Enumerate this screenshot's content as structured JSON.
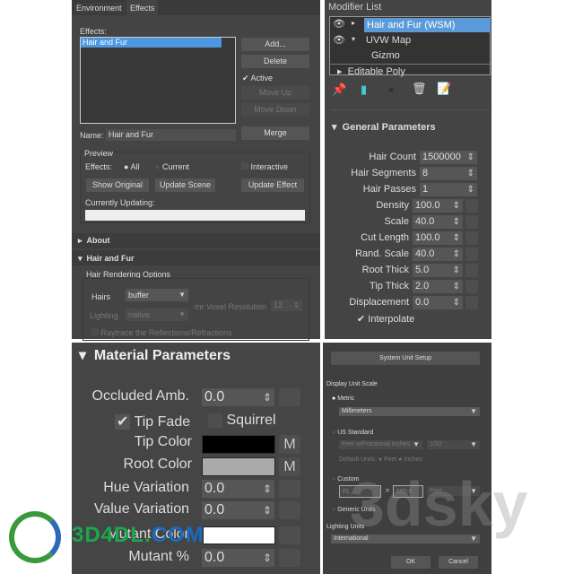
{
  "effects_panel": {
    "tabs": [
      "Environment",
      "Effects"
    ],
    "effects_label": "Effects:",
    "effects_list": [
      "Hair and Fur"
    ],
    "buttons": {
      "add": "Add...",
      "delete": "Delete",
      "move_up": "Move Up",
      "move_down": "Move Down",
      "merge": "Merge"
    },
    "active_label": "Active",
    "name_label": "Name:",
    "name_value": "Hair and Fur",
    "preview": {
      "title": "Preview",
      "effects_label": "Effects:",
      "all": "All",
      "current": "Current",
      "interactive": "Interactive",
      "show_original": "Show Original",
      "update_scene": "Update Scene",
      "update_effect": "Update Effect",
      "currently_updating": "Currently Updating:"
    },
    "about": "About",
    "hair_and_fur": "Hair and Fur",
    "hair_rendering_options": "Hair Rendering Options",
    "hairs_label": "Hairs",
    "hairs_value": "buffer",
    "lighting_label": "Lighting",
    "lighting_value": "native",
    "voxel_label": "mr Voxel Resolution",
    "voxel_value": "12",
    "raytrace_label": "Raytrace the Reflections/Refractions"
  },
  "modifier_panel": {
    "title": "Modifier List",
    "stack": [
      "Hair and Fur (WSM)",
      "UVW Map",
      "Gizmo",
      "Editable Poly"
    ],
    "section": "General Parameters",
    "params": [
      {
        "label": "Hair Count",
        "value": "1500000"
      },
      {
        "label": "Hair Segments",
        "value": "8"
      },
      {
        "label": "Hair Passes",
        "value": "1"
      },
      {
        "label": "Density",
        "value": "100.0"
      },
      {
        "label": "Scale",
        "value": "40.0"
      },
      {
        "label": "Cut Length",
        "value": "100.0"
      },
      {
        "label": "Rand. Scale",
        "value": "40.0"
      },
      {
        "label": "Root Thick",
        "value": "5.0"
      },
      {
        "label": "Tip Thick",
        "value": "2.0"
      },
      {
        "label": "Displacement",
        "value": "0.0"
      }
    ],
    "interpolate": "Interpolate"
  },
  "material_panel": {
    "title": "Material Parameters",
    "occluded_label": "Occluded Amb.",
    "occluded_value": "0.0",
    "tip_fade": "Tip Fade",
    "squirrel": "Squirrel",
    "tip_color_label": "Tip Color",
    "tip_color": "#000000",
    "root_color_label": "Root Color",
    "root_color": "#aaaaaa",
    "map_button": "M",
    "hue_label": "Hue Variation",
    "hue_value": "0.0",
    "value_label": "Value Variation",
    "value_value": "0.0",
    "mutant_color_label": "Mutant Color",
    "mutant_color": "#ffffff",
    "mutant_pct_label": "Mutant %",
    "mutant_pct_value": "0.0"
  },
  "units_panel": {
    "system_unit_setup": "System Unit Setup",
    "display_unit_scale": "Display Unit Scale",
    "metric": "Metric",
    "metric_value": "Millimeters",
    "us_standard": "US Standard",
    "us_value": "Feet w/Fractional Inches",
    "us_fraction": "1/32",
    "default_units": "Default Units:",
    "feet": "Feet",
    "inches": "Inches",
    "custom": "Custom",
    "custom_left": "FL",
    "custom_eq": "=",
    "custom_value": "660.0",
    "custom_unit": "Feet",
    "generic_units": "Generic Units",
    "lighting_units": "Lighting Units",
    "lighting_value": "International",
    "ok": "OK",
    "cancel": "Cancel"
  },
  "watermarks": {
    "logo": "3D4DL.COM",
    "bg": "3dsky"
  }
}
